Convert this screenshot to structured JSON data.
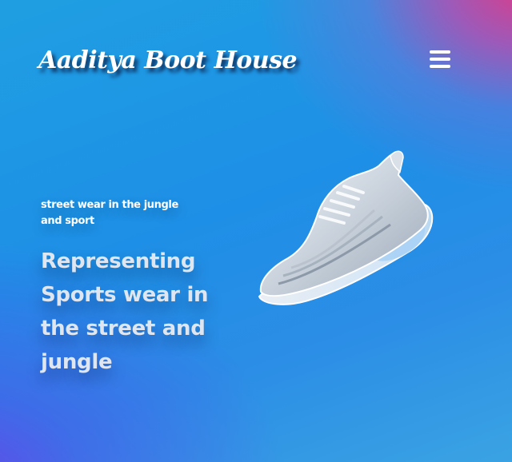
{
  "header": {
    "brand_name": "Aaditya Boot House",
    "menu_icon": "hamburger-menu-icon"
  },
  "hero": {
    "tagline": "street wear in the jungle and sport",
    "headline": "Representing Sports wear in the street and jungle",
    "image": "sneaker-image"
  },
  "colors": {
    "background_primary": "#1f9fe2",
    "background_corner_top_right": "#e83682",
    "background_corner_bottom_left": "#6e3ce6",
    "headline_text": "#dfe6f0",
    "brand_text": "#ffffff"
  }
}
